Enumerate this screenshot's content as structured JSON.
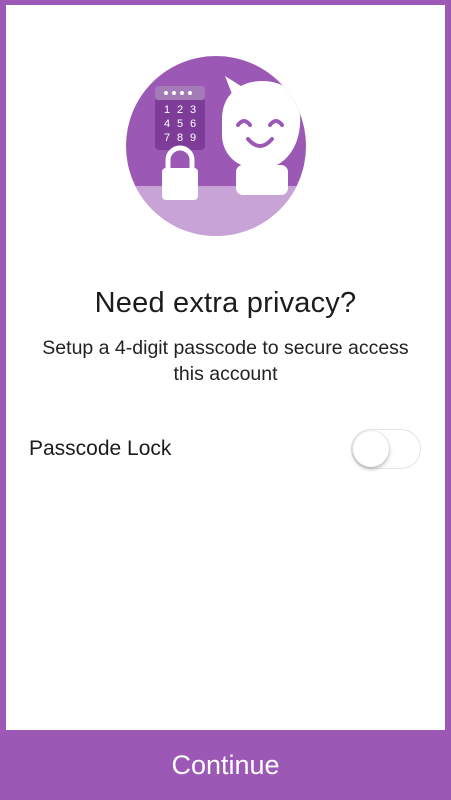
{
  "illustration": {
    "icon": "passcode-lock-mascot-illustration",
    "keypad_digits": [
      "1",
      "2",
      "3",
      "4",
      "5",
      "6",
      "7",
      "8",
      "9"
    ],
    "colors": {
      "circle": "#9b58b5",
      "circle_bottom": "#c8a4d6",
      "keypad": "#7d3c98"
    }
  },
  "main": {
    "title": "Need extra privacy?",
    "subtitle": "Setup a 4-digit passcode to secure access this account"
  },
  "passcode_lock": {
    "label": "Passcode Lock",
    "enabled": false
  },
  "footer": {
    "continue_label": "Continue"
  },
  "colors": {
    "accent": "#9b58b5",
    "background": "#ffffff"
  }
}
